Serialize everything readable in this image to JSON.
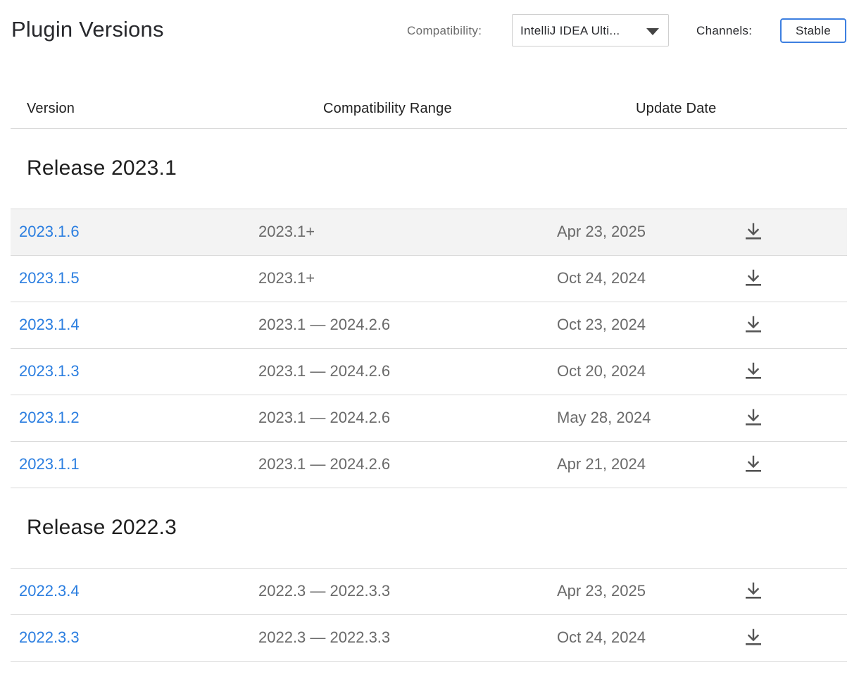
{
  "header": {
    "title": "Plugin Versions",
    "compat_label": "Compatibility:",
    "compat_value": "IntelliJ IDEA Ulti...",
    "channels_label": "Channels:",
    "channel_value": "Stable"
  },
  "table": {
    "columns": [
      "Version",
      "Compatibility Range",
      "Update Date"
    ],
    "releases": [
      {
        "title": "Release 2023.1",
        "rows": [
          {
            "version": "2023.1.6",
            "range": "2023.1+",
            "date": "Apr 23, 2025"
          },
          {
            "version": "2023.1.5",
            "range": "2023.1+",
            "date": "Oct 24, 2024"
          },
          {
            "version": "2023.1.4",
            "range": "2023.1 — 2024.2.6",
            "date": "Oct 23, 2024"
          },
          {
            "version": "2023.1.3",
            "range": "2023.1 — 2024.2.6",
            "date": "Oct 20, 2024"
          },
          {
            "version": "2023.1.2",
            "range": "2023.1 — 2024.2.6",
            "date": "May 28, 2024"
          },
          {
            "version": "2023.1.1",
            "range": "2023.1 — 2024.2.6",
            "date": "Apr 21, 2024"
          }
        ]
      },
      {
        "title": "Release 2022.3",
        "rows": [
          {
            "version": "2022.3.4",
            "range": "2022.3 — 2022.3.3",
            "date": "Apr 23, 2025"
          },
          {
            "version": "2022.3.3",
            "range": "2022.3 — 2022.3.3",
            "date": "Oct 24, 2024"
          }
        ]
      }
    ]
  },
  "icons": {
    "download": "download-icon",
    "dropdown": "chevron-down-icon"
  },
  "colors": {
    "link": "#2b7ee0",
    "accent_border": "#3d7fe0",
    "hover_row": "#f3f3f3"
  }
}
